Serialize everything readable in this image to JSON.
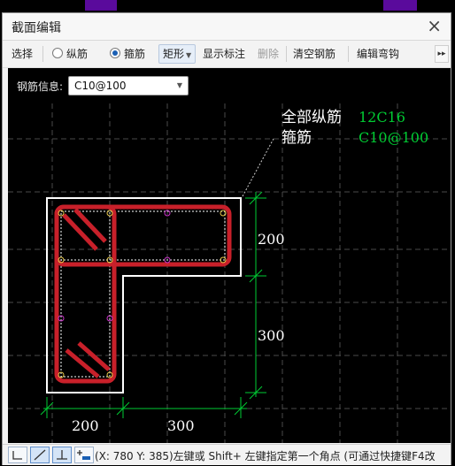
{
  "window": {
    "title": "截面编辑",
    "close_glyph": "×"
  },
  "toolbar": {
    "select_label": "选择",
    "longitudinal_label": "纵筋",
    "stirrup_label": "箍筋",
    "selected_mode": "箍筋",
    "shape_label": "矩形",
    "show_annotation_label": "显示标注",
    "delete_label": "删除",
    "clear_rebar_label": "清空钢筋",
    "edit_hook_label": "编辑弯钩",
    "more_glyph": "▸▸"
  },
  "rebar_info": {
    "label": "钢筋信息:",
    "value": "C10@100"
  },
  "drawing": {
    "annotations": [
      {
        "label": "全部纵筋",
        "value": "12C16"
      },
      {
        "label": "箍筋",
        "value": "C10@100"
      }
    ],
    "dimensions": {
      "right_top": "200",
      "right_bottom": "300",
      "bottom_left": "200",
      "bottom_right": "300"
    },
    "colors": {
      "section_outline": "#ffffff",
      "rebar": "#c8202a",
      "dimension": "#00cc33",
      "annotation_value": "#00cc33",
      "annotation_label": "#ffffff",
      "grid": "#4a4a4a",
      "middle_bar_marker": "#cc33cc"
    }
  },
  "statusbar": {
    "text": "(X: 780 Y: 385)左键或 Shift+ 左键指定第一个角点 (可通过快捷键F4改",
    "buttons": [
      "ortho-mode-button",
      "line-mode-button",
      "perpendicular-mode-button",
      "add-point-button"
    ]
  }
}
